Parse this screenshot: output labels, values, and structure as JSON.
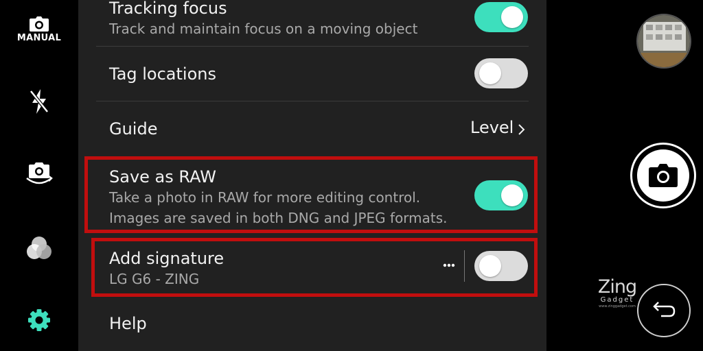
{
  "sidebar": {
    "mode_label": "MANUAL",
    "icons": [
      "camera-mode-icon",
      "flash-off-icon",
      "switch-camera-icon",
      "filter-icon",
      "settings-icon"
    ],
    "accent": "#3ddfbd"
  },
  "settings": [
    {
      "id": "tracking_focus",
      "title": "Tracking focus",
      "subtitle": "Track and maintain focus on a moving object",
      "toggle": true
    },
    {
      "id": "tag_locations",
      "title": "Tag locations",
      "toggle": false
    },
    {
      "id": "guide",
      "title": "Guide",
      "value": "Level"
    },
    {
      "id": "save_raw",
      "title": "Save as RAW",
      "subtitle_1": "Take a photo in RAW for more editing control.",
      "subtitle_2": "Images are saved in both DNG and JPEG formats.",
      "toggle": true
    },
    {
      "id": "add_signature",
      "title": "Add signature",
      "subtitle": "LG G6 - ZING",
      "toggle": false
    },
    {
      "id": "help",
      "title": "Help"
    }
  ],
  "watermark": {
    "main": "Zing",
    "sub": "Gadget",
    "url": "www.zinggadget.com"
  },
  "colors": {
    "toggle_on": "#3ddfbd",
    "toggle_off": "#dcdcdc",
    "highlight": "#c10e0e",
    "panel": "#212121"
  }
}
